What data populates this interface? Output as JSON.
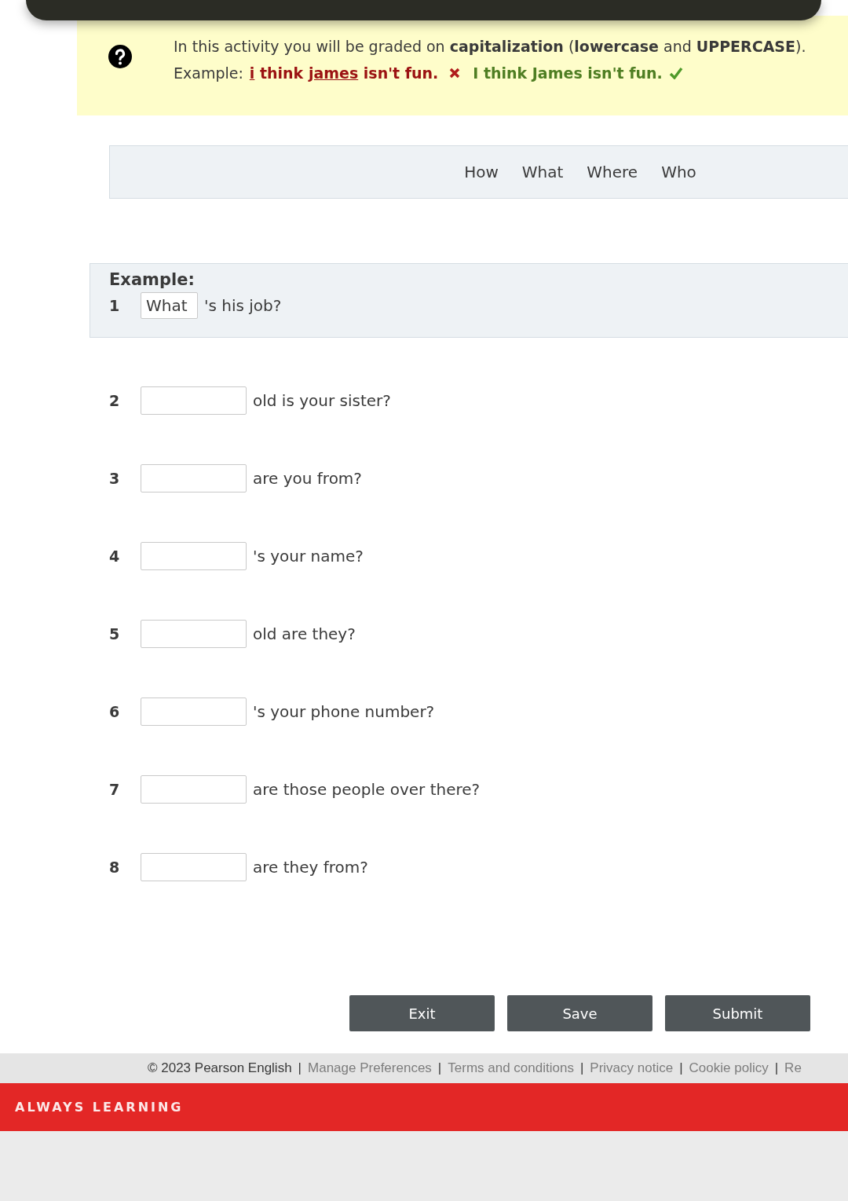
{
  "instructions": {
    "text": "In this activity you will be graded on **capitalization** (**lowercase** and **UPPERCASE**).",
    "example_label": "Example:",
    "wrong_example": [
      {
        "text": "i",
        "underlined": true
      },
      {
        "text": " think ",
        "underlined": false
      },
      {
        "text": "james",
        "underlined": true
      },
      {
        "text": " isn't fun.",
        "underlined": false
      }
    ],
    "correct_example": "I think James isn't fun."
  },
  "word_bank": [
    "How",
    "What",
    "Where",
    "Who"
  ],
  "example": {
    "heading": "Example:",
    "number": "1",
    "value": "What",
    "text": "'s his job?"
  },
  "questions": [
    {
      "number": "2",
      "text": "old is your sister?"
    },
    {
      "number": "3",
      "text": "are you from?"
    },
    {
      "number": "4",
      "text": "'s your name?"
    },
    {
      "number": "5",
      "text": "old are they?"
    },
    {
      "number": "6",
      "text": "'s your phone number?"
    },
    {
      "number": "7",
      "text": "are those people over there?"
    },
    {
      "number": "8",
      "text": "are they from?"
    }
  ],
  "buttons": [
    "Exit",
    "Save",
    "Submit"
  ],
  "footer": {
    "copyright": "© 2023 Pearson English",
    "separator": "|",
    "links": [
      "Manage Preferences",
      "Terms and conditions",
      "Privacy notice",
      "Cookie policy",
      "Re"
    ]
  },
  "brand_bar": {
    "tagline": "ALWAYS LEARNING"
  }
}
